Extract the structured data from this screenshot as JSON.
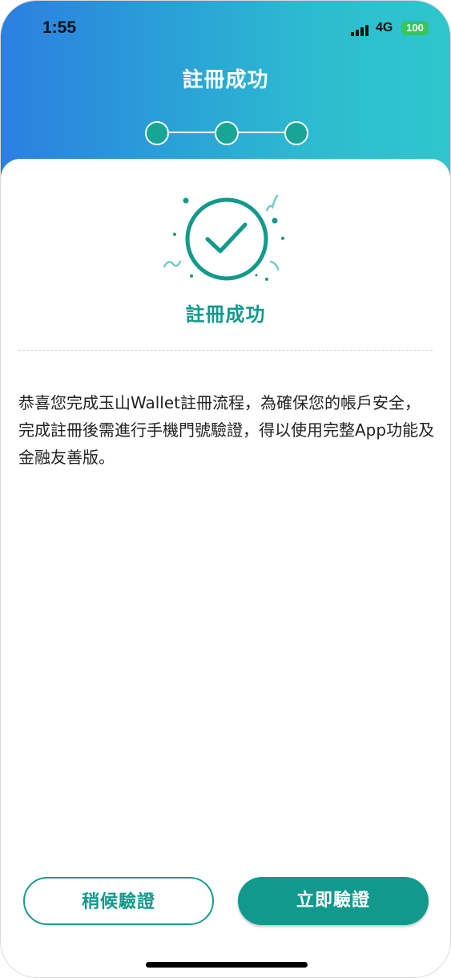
{
  "status_bar": {
    "time": "1:55",
    "network": "4G",
    "battery": "100"
  },
  "header": {
    "title": "註冊成功"
  },
  "stepper": {
    "total_steps": 3,
    "completed_steps": 3
  },
  "content": {
    "success_title": "註冊成功",
    "message": "恭喜您完成玉山Wallet註冊流程，為確保您的帳戶安全，完成註冊後需進行手機門號驗證，得以使用完整App功能及金融友善版。"
  },
  "actions": {
    "later_label": "稍候驗證",
    "now_label": "立即驗證"
  },
  "colors": {
    "primary": "#119a8c",
    "header_gradient_start": "#2b7fe0",
    "header_gradient_end": "#2fc6cd",
    "battery": "#34c759"
  },
  "icons": {
    "success": "check-circle-icon",
    "signal": "signal-bars-icon"
  }
}
